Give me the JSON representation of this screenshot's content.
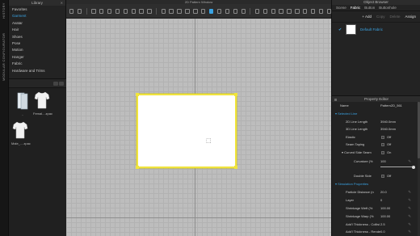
{
  "side_strip": {
    "history": "HISTORY",
    "modular": "MODULAR CONFIGURATOR"
  },
  "library": {
    "title": "Library",
    "items": [
      {
        "label": "Favorites",
        "active": false
      },
      {
        "label": "Garment",
        "active": true
      },
      {
        "label": "Avatar",
        "active": false
      },
      {
        "label": "Hair",
        "active": false
      },
      {
        "label": "Shoes",
        "active": false
      },
      {
        "label": "Pose",
        "active": false
      },
      {
        "label": "Motion",
        "active": false
      },
      {
        "label": "Hanger",
        "active": false
      },
      {
        "label": "Fabric",
        "active": false
      },
      {
        "label": "Hardware and Trims",
        "active": false
      }
    ],
    "assets": [
      {
        "label": "..",
        "icon": "folder-up-icon"
      },
      {
        "label": "Femal....zpac",
        "icon": "tshirt-icon"
      },
      {
        "label": "Male_....zpac",
        "icon": "tshirt-icon"
      }
    ]
  },
  "viewport": {
    "title": "2D Pattern Window"
  },
  "object_browser": {
    "title": "Object Browser",
    "tabs": [
      "Scene",
      "Fabric",
      "Button",
      "Buttonhole"
    ],
    "active_tab": "Fabric",
    "actions": {
      "add": "+ Add",
      "copy": "Copy",
      "delete": "Delete",
      "assign": "Assign"
    },
    "fabric_item": "Default Fabric"
  },
  "property_editor": {
    "title": "Property Editor",
    "name_label": "Name",
    "name_value": "Pattern2D_561",
    "sections": {
      "selected_line": "Selected Line",
      "simulation": "Simulation Properties"
    },
    "rows": {
      "line_length_2d": {
        "label": "2D Line Length",
        "value": "3940.0mm"
      },
      "line_length_3d": {
        "label": "3D Line Length",
        "value": "3940.0mm"
      },
      "elastic": {
        "label": "Elastic",
        "value": "Off"
      },
      "seam_taping": {
        "label": "Seam Taping",
        "value": "Off"
      },
      "curved_side_seam": {
        "label": "Curved Side Seam",
        "value": "On"
      },
      "curvature": {
        "label": "Curvature (%",
        "value": "100",
        "fraction": 0.97
      },
      "double_side": {
        "label": "Double Side",
        "value": "Off"
      },
      "particle_distance": {
        "label": "Particle Distance (n",
        "value": "20.0"
      },
      "layer": {
        "label": "Layer",
        "value": "0"
      },
      "shrinkage_weft": {
        "label": "Shrinkage Weft (%",
        "value": "100.00"
      },
      "shrinkage_warp": {
        "label": "Shrinkage Warp (%",
        "value": "100.00"
      },
      "add_thickness_collision": {
        "label": "Add'l Thickness - Collisi",
        "value": "2.5"
      },
      "add_thickness_render": {
        "label": "Add'l Thickness - Rende",
        "value": "0.0"
      }
    }
  },
  "colors": {
    "accent": "#3aa3e3",
    "selection": "#f0e43c",
    "grid": "#bdbdbd"
  }
}
